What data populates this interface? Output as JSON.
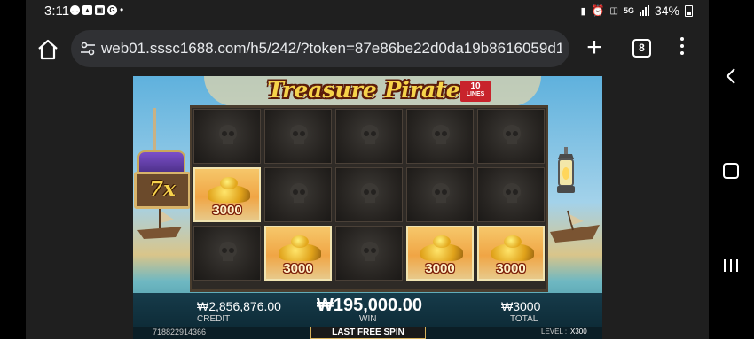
{
  "status": {
    "time": "3:11",
    "notif_icons": [
      "chat-bubble-icon",
      "image-icon",
      "gallery-icon",
      "google-g-icon"
    ],
    "dot": "•",
    "network": "5G",
    "battery": "34%"
  },
  "browser": {
    "url": "web01.sssc1688.com/h5/242/?token=87e86be22d0da19b8616059d1",
    "tab_count": "8"
  },
  "game": {
    "title": "Treasure Pirate",
    "lines_number": "10",
    "lines_label": "LINES",
    "multiplier": "7x",
    "grid": [
      [
        "skull",
        "skull",
        "skull",
        "skull",
        "skull"
      ],
      [
        "3000",
        "skull",
        "skull",
        "skull",
        "skull"
      ],
      [
        "skull",
        "3000",
        "skull",
        "3000",
        "3000"
      ]
    ],
    "credit": "₩2,856,876.00",
    "credit_label": "CREDIT",
    "win": "₩195,000.00",
    "win_label": "WIN",
    "total": "₩3000",
    "total_label": "TOTAL",
    "round_id": "718822914366",
    "free_spin_label": "LAST FREE SPIN",
    "level_label": "LEVEL :",
    "level_value": "X300"
  },
  "colors": {
    "gold_text": "#f6d34a",
    "browser_bg": "#1f1f1f",
    "url_bar": "#303134"
  }
}
